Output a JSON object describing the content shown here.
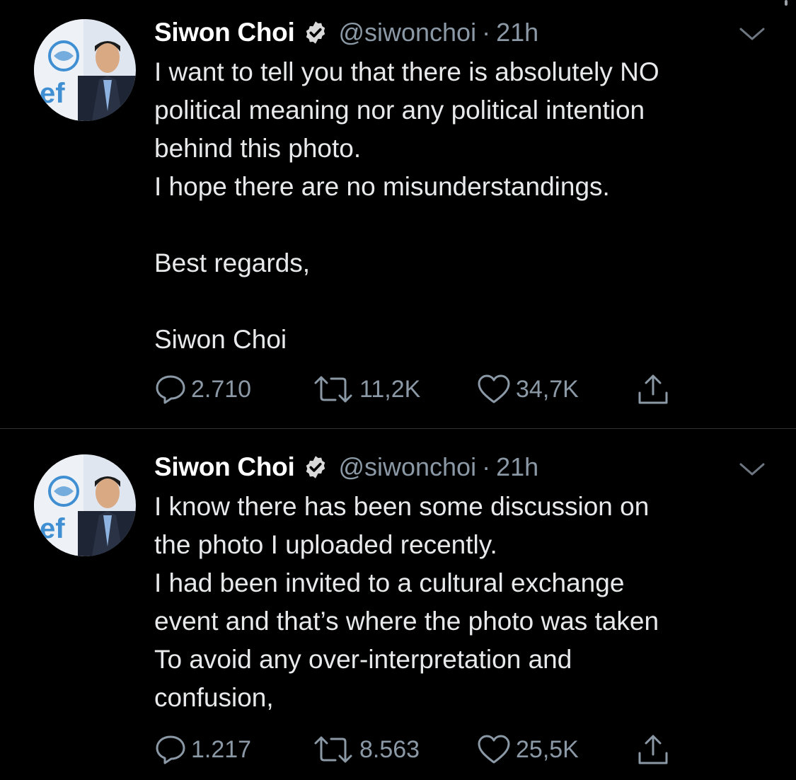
{
  "colors": {
    "background": "#000000",
    "text": "#e7e9ea",
    "secondary": "#8b98a5",
    "divider": "#2f3336"
  },
  "tweets": [
    {
      "author": {
        "name": "Siwon Choi",
        "handle": "@siwonchoi",
        "verified": true
      },
      "separator": "·",
      "time": "21h",
      "text": "I want to tell you that there is absolutely NO\npolitical meaning nor any political intention\nbehind this photo.\nI hope there are no misunderstandings.\n\nBest regards,\n\nSiwon Choi",
      "stats": {
        "replies": "2.710",
        "retweets": "11,2K",
        "likes": "34,7K"
      }
    },
    {
      "author": {
        "name": "Siwon Choi",
        "handle": "@siwonchoi",
        "verified": true
      },
      "separator": "·",
      "time": "21h",
      "text": "I know there has been some discussion on\nthe photo I uploaded recently.\nI had been invited to a cultural exchange\nevent and that’s where the photo was taken\nTo avoid any over-interpretation and\nconfusion,",
      "stats": {
        "replies": "1.217",
        "retweets": "8.563",
        "likes": "25,5K"
      }
    }
  ],
  "icons": {
    "verified": "verified-badge-icon",
    "caret": "chevron-down-icon",
    "reply": "reply-bubble-icon",
    "retweet": "retweet-icon",
    "like": "heart-icon",
    "share": "share-icon"
  }
}
